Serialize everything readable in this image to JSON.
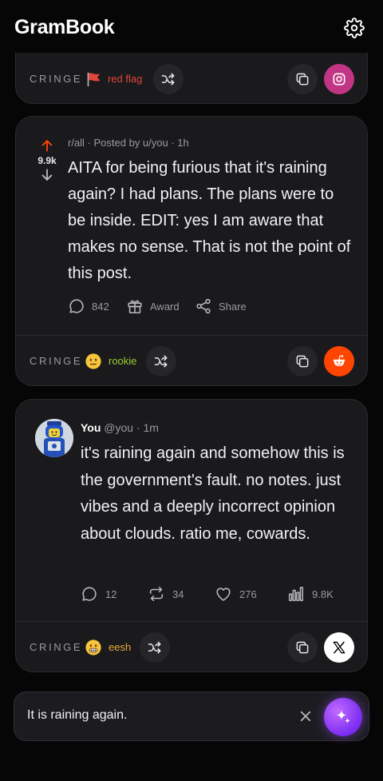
{
  "app": {
    "title": "GramBook"
  },
  "icons": {
    "settings": "gear-icon",
    "shuffle": "shuffle-icon",
    "copy": "copy-icon",
    "instagram": "instagram-icon",
    "reddit": "reddit-icon",
    "x": "x-logo-icon",
    "sparkle": "sparkle-icon"
  },
  "colors": {
    "instagram_brand": "#c13584",
    "reddit_brand": "#ff4500",
    "x_brand": "#ffffff",
    "upvote": "#ff4500",
    "red_flag": "#e0453a",
    "rookie": "#9acd32",
    "eesh": "#e8a93a",
    "send_accent": "#9b4dff"
  },
  "posts": [
    {
      "platform": "instagram",
      "cringe_label": "CRINGE",
      "badge": {
        "icon": "red-flag-icon",
        "text": "red flag"
      }
    },
    {
      "platform": "reddit",
      "meta": "r/all · Posted by u/you · 1h",
      "votes": "9.9k",
      "body": "AITA for being furious that it's raining again? I had plans. The plans were to be inside. EDIT: yes I am aware that makes no sense. That is not the point of this post.",
      "comments": "842",
      "award_label": "Award",
      "share_label": "Share",
      "cringe_label": "CRINGE",
      "badge": {
        "icon": "neutral-face-icon",
        "text": "rookie"
      }
    },
    {
      "platform": "x",
      "author_name": "You",
      "author_handle": "@you · 1m",
      "body": "it's raining again and somehow this is the government's fault. no notes. just vibes and a deeply incorrect opinion about clouds. ratio me, cowards.",
      "replies": "12",
      "reposts": "34",
      "likes": "276",
      "views": "9.8K",
      "cringe_label": "CRINGE",
      "badge": {
        "icon": "grimacing-face-icon",
        "text": "eesh"
      }
    }
  ],
  "composer": {
    "value": "It is raining again.",
    "placeholder": "It is raining again."
  }
}
